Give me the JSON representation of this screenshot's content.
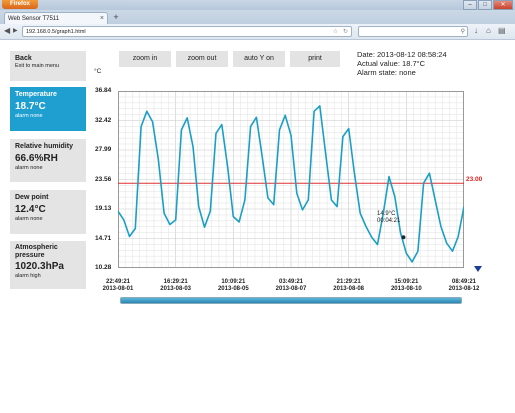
{
  "browser": {
    "app_button": "Firefox",
    "tab_title": "Web Sensor T7511",
    "url": "192.168.0.5/graph1.html"
  },
  "sidebar": {
    "back": {
      "label": "Back",
      "sub": "Exit to main menu"
    },
    "items": [
      {
        "label": "Temperature",
        "value": "18.7°C",
        "alarm": "alarm none",
        "active": true
      },
      {
        "label": "Relative humidity",
        "value": "66.6%RH",
        "alarm": "alarm none",
        "active": false
      },
      {
        "label": "Dew point",
        "value": "12.4°C",
        "alarm": "alarm none",
        "active": false
      },
      {
        "label": "Atmospheric pressure",
        "value": "1020.3hPa",
        "alarm": "alarm high",
        "active": false
      }
    ]
  },
  "toolbar": {
    "zoom_in": "zoom in",
    "zoom_out": "zoom out",
    "auto_y": "auto Y on",
    "print": "print"
  },
  "info": {
    "date": "Date: 2013-08-12 08:58:24",
    "actual": "Actual value: 18.7°C",
    "alarm_state": "Alarm state: none"
  },
  "chart": {
    "unit": "°C",
    "alarm_limit_label": "23.00",
    "cursor_value": "14.9°C",
    "cursor_time": "00:04:21"
  },
  "chart_data": {
    "type": "line",
    "ylabel": "°C",
    "ylim": [
      10.28,
      36.84
    ],
    "y_ticks": [
      "36.84",
      "32.42",
      "27.99",
      "23.56",
      "19.13",
      "14.71",
      "10.28"
    ],
    "x_ticks": [
      {
        "time": "22:49:21",
        "date": "2013-08-01"
      },
      {
        "time": "16:29:21",
        "date": "2013-08-03"
      },
      {
        "time": "10:09:21",
        "date": "2013-08-05"
      },
      {
        "time": "03:49:21",
        "date": "2013-08-07"
      },
      {
        "time": "21:29:21",
        "date": "2013-08-08"
      },
      {
        "time": "15:09:21",
        "date": "2013-08-10"
      },
      {
        "time": "08:49:21",
        "date": "2013-08-12"
      }
    ],
    "alarm_limit": 23.0,
    "series": [
      {
        "color": "#1a9fc4",
        "x": [
          0,
          0.3,
          0.6,
          0.9,
          1.2,
          1.5,
          1.8,
          2.1,
          2.4,
          2.7,
          3.0,
          3.3,
          3.6,
          3.9,
          4.2,
          4.5,
          4.8,
          5.1,
          5.4,
          5.7,
          6.0,
          6.3,
          6.6,
          6.9,
          7.2,
          7.5,
          7.8,
          8.1,
          8.4,
          8.7,
          9.0,
          9.3,
          9.6,
          9.9,
          10.2,
          10.5,
          10.8,
          11.1,
          11.4,
          11.7,
          12.0,
          12.3,
          12.6,
          12.9,
          13.2,
          13.5,
          13.8,
          14.1,
          14.4,
          14.7,
          15.0,
          15.3,
          15.6,
          15.9,
          16.2,
          16.5,
          16.8,
          17.1,
          17.4,
          17.7,
          18.0
        ],
        "values": [
          18.8,
          17.5,
          15.0,
          16.2,
          31.5,
          33.8,
          32.2,
          26.5,
          18.5,
          16.8,
          17.5,
          31.0,
          32.8,
          28.5,
          19.5,
          16.4,
          18.8,
          30.5,
          31.8,
          25.5,
          18.0,
          17.2,
          20.5,
          31.5,
          32.9,
          27.0,
          20.8,
          19.8,
          31.0,
          33.2,
          30.2,
          21.5,
          19.0,
          20.5,
          33.8,
          34.6,
          27.5,
          20.5,
          19.5,
          30.0,
          31.2,
          24.5,
          18.5,
          16.5,
          14.9,
          13.8,
          18.5,
          24.0,
          21.0,
          15.5,
          12.5,
          11.2,
          12.8,
          23.0,
          24.5,
          20.5,
          16.5,
          14.0,
          12.8,
          15.0,
          19.5
        ]
      }
    ],
    "cursor": {
      "x": 14.85,
      "y": 14.9
    },
    "grid": true
  }
}
